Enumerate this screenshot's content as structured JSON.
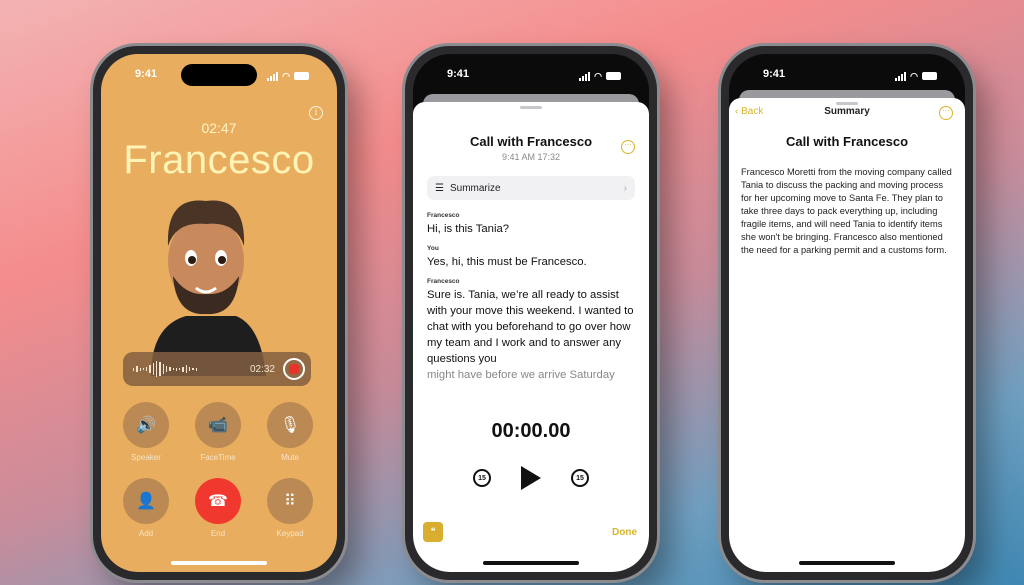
{
  "status_time": "9:41",
  "call_screen": {
    "info_icon": "info-icon",
    "timer": "02:47",
    "caller": "Francesco",
    "recording": {
      "time": "02:32"
    },
    "buttons": [
      {
        "label": "Speaker",
        "icon": "🔊"
      },
      {
        "label": "FaceTime",
        "icon": "📹"
      },
      {
        "label": "Mute",
        "icon": "🎙"
      },
      {
        "label": "Add",
        "icon": "👤"
      },
      {
        "label": "End",
        "icon": "☎"
      },
      {
        "label": "Keypad",
        "icon": "⠿"
      }
    ]
  },
  "transcript_screen": {
    "title": "Call with Francesco",
    "subtitle": "9:41 AM  17:32",
    "summarize_label": "Summarize",
    "messages": [
      {
        "speaker": "Francesco",
        "text": "Hi, is this Tania?"
      },
      {
        "speaker": "You",
        "text": "Yes, hi, this must be Francesco."
      },
      {
        "speaker": "Francesco",
        "text": "Sure is. Tania, we’re all ready to assist with your move this weekend. I wanted to chat with you beforehand to go over how my team and I work and to answer any questions you",
        "fade": "might have before we arrive Saturday"
      }
    ],
    "playback_time": "00:00.00",
    "skip_back": "15",
    "skip_forward": "15",
    "done_label": "Done"
  },
  "summary_screen": {
    "back_label": "Back",
    "nav_title": "Summary",
    "title": "Call with Francesco",
    "summary": "Francesco Moretti from the moving company called Tania to discuss the packing and moving process for her upcoming move to Santa Fe. They plan to take three days to pack everything up, including fragile items, and will need Tania to identify items she won't be bringing. Francesco also mentioned the need for a parking permit and a customs form."
  },
  "colors": {
    "accent": "#d9b52a",
    "end_red": "#f0382e",
    "call_bg": "#e8ad5f"
  }
}
